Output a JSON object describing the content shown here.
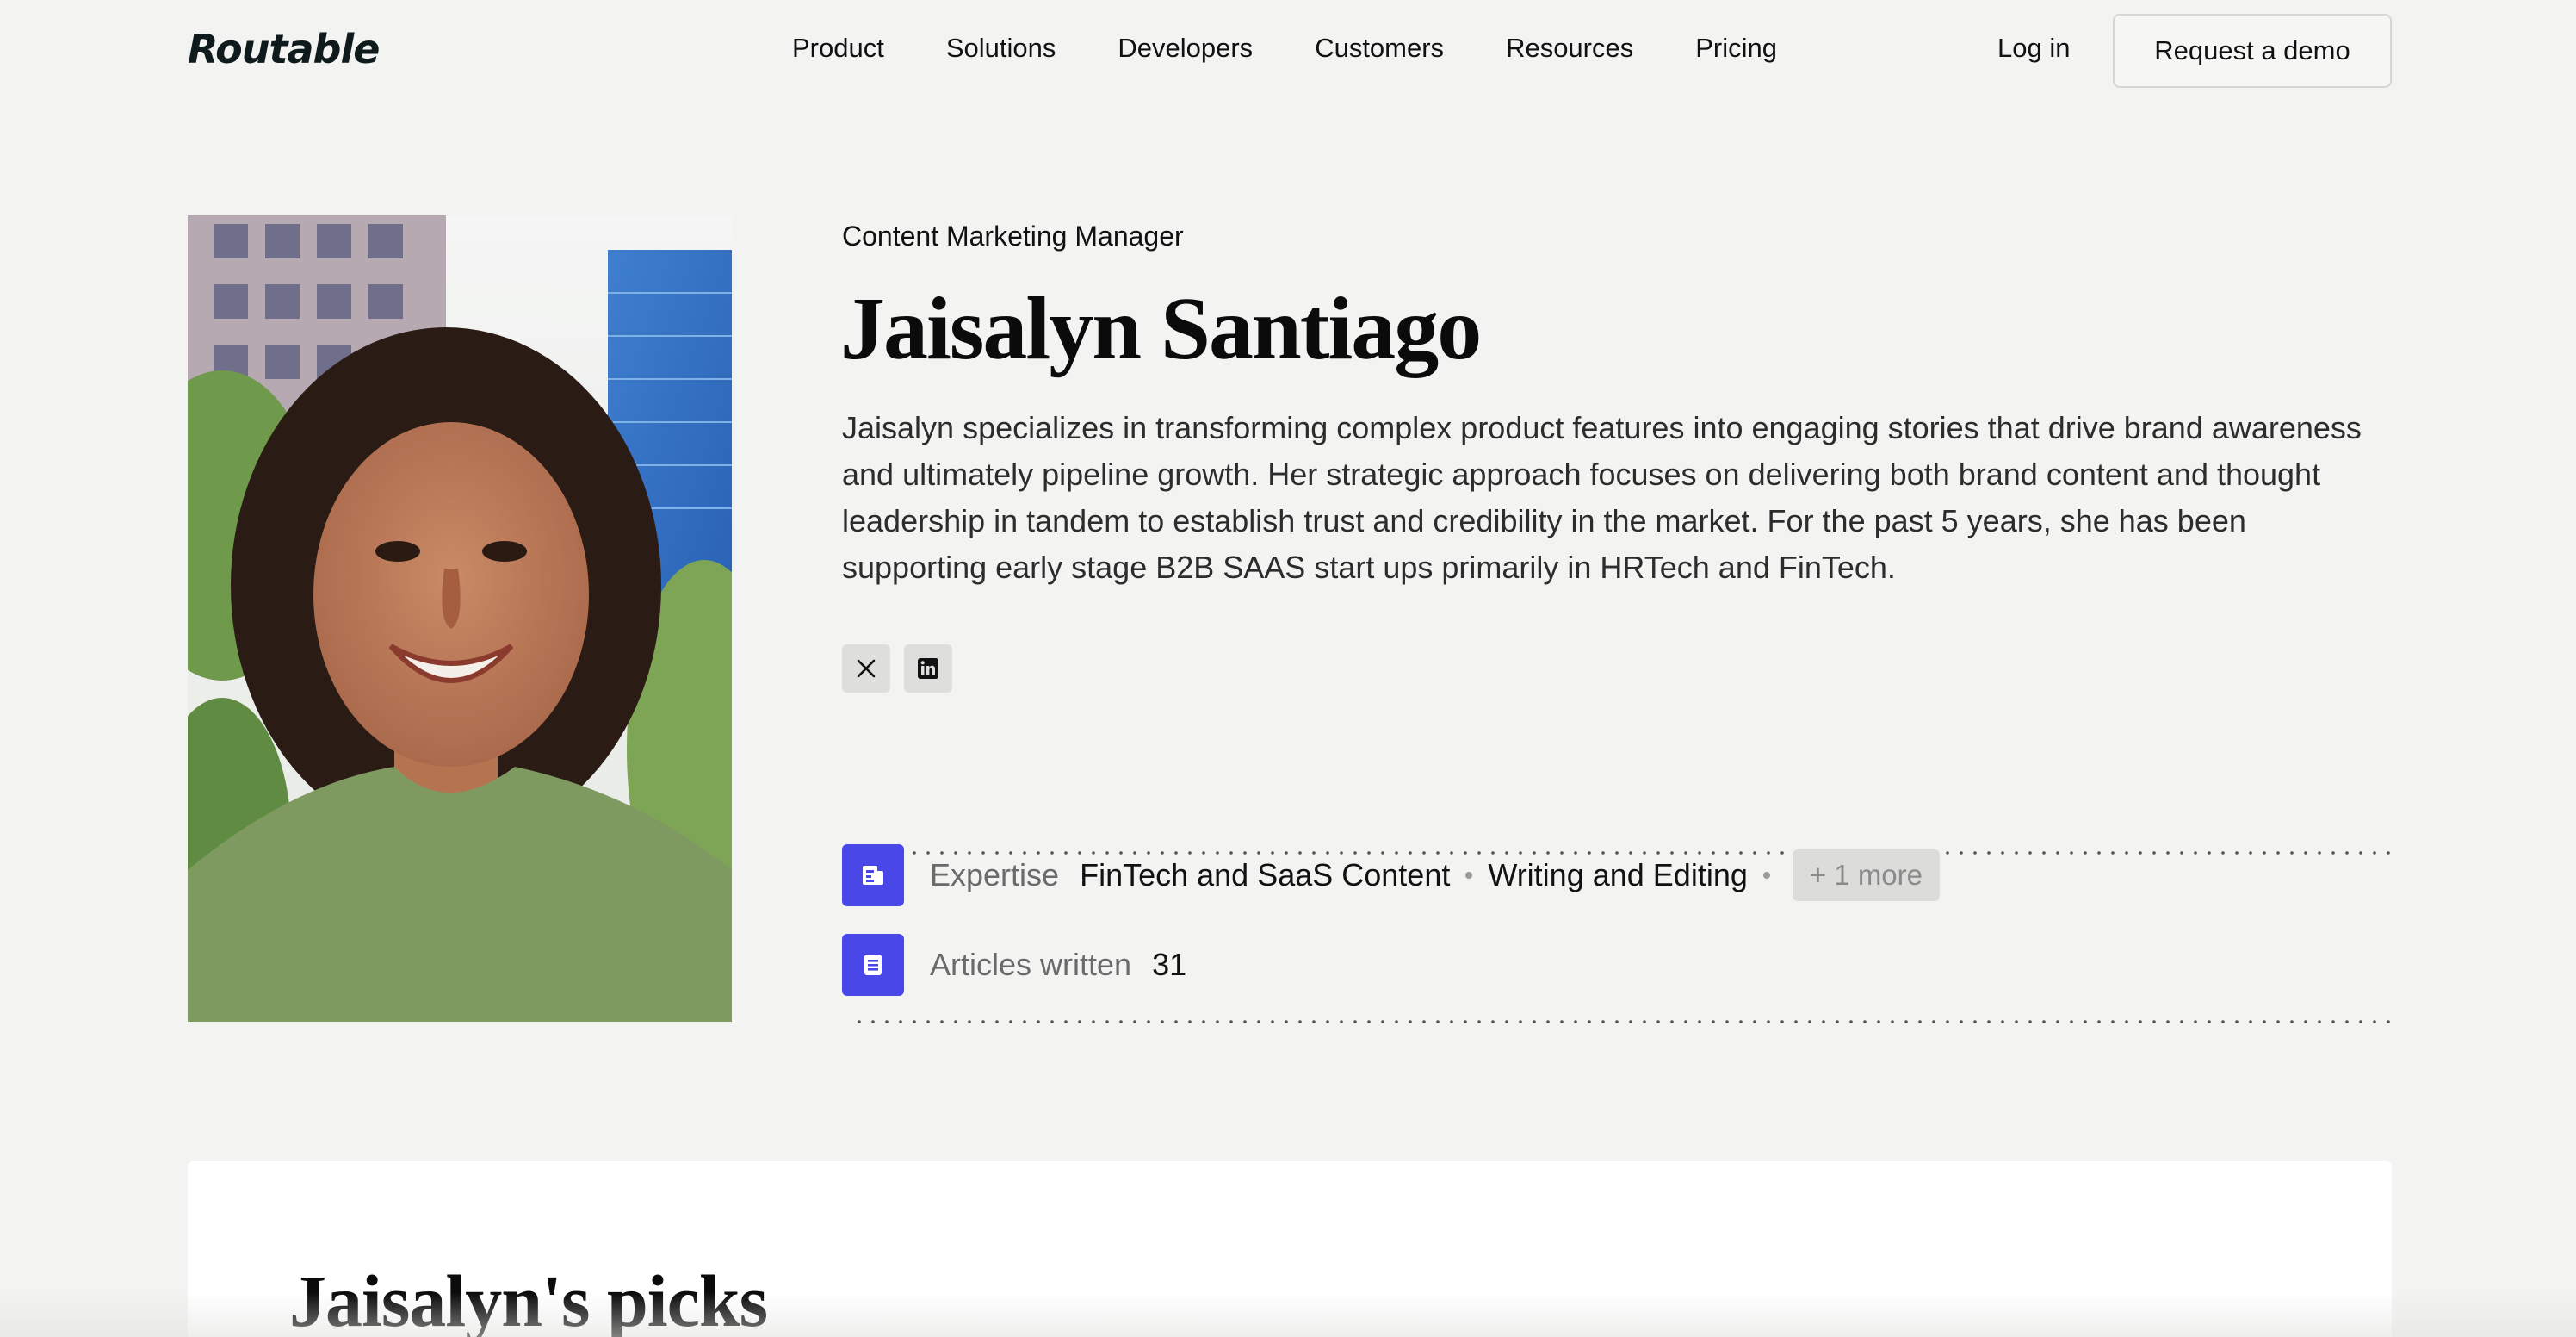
{
  "brand": {
    "logo_text": "Routable"
  },
  "nav": {
    "links": [
      "Product",
      "Solutions",
      "Developers",
      "Customers",
      "Resources",
      "Pricing"
    ],
    "login_label": "Log in",
    "demo_label": "Request a demo"
  },
  "profile": {
    "role": "Content Marketing Manager",
    "name": "Jaisalyn Santiago",
    "bio": "Jaisalyn specializes in transforming complex product features into engaging stories that drive brand awareness and ultimately pipeline growth. Her strategic approach focuses on delivering both brand content and thought leadership in tandem to establish trust and credibility in the market. For the past 5 years, she has been supporting early stage B2B SAAS start ups primarily in HRTech and FinTech.",
    "socials": [
      {
        "icon": "x-icon"
      },
      {
        "icon": "linkedin-icon"
      }
    ],
    "expertise": {
      "label": "Expertise",
      "items": [
        "FinTech and SaaS Content",
        "Writing and Editing"
      ],
      "more_label": "+ 1 more"
    },
    "articles": {
      "label": "Articles written",
      "count": "31"
    }
  },
  "picks": {
    "title": "Jaisalyn's picks"
  },
  "colors": {
    "background": "#f3f3f2",
    "accent": "#4a47e8",
    "card": "#ffffff"
  }
}
